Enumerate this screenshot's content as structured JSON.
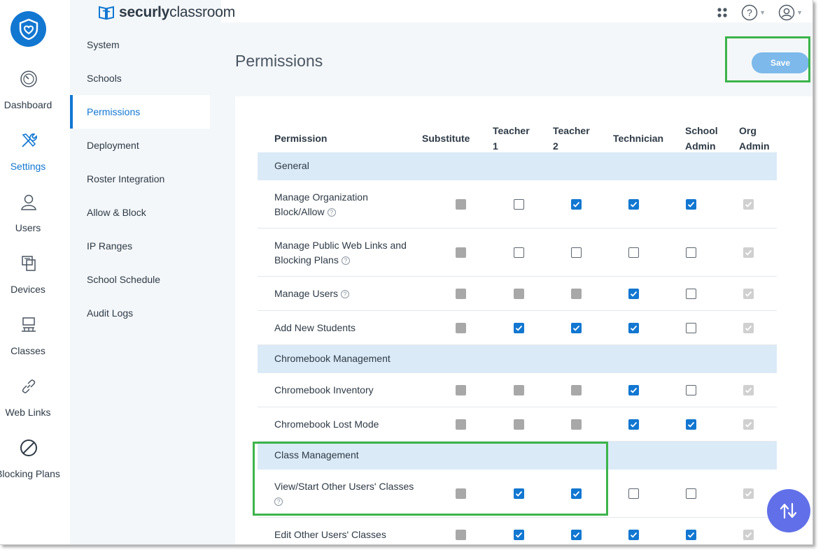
{
  "app": {
    "brand_bold": "securly",
    "brand_light": "classroom"
  },
  "rail": [
    {
      "label": "Dashboard",
      "icon": "speedometer-icon"
    },
    {
      "label": "Settings",
      "icon": "tools-icon",
      "active": true
    },
    {
      "label": "Users",
      "icon": "user-icon"
    },
    {
      "label": "Devices",
      "icon": "devices-icon"
    },
    {
      "label": "Classes",
      "icon": "classes-icon"
    },
    {
      "label": "Web Links",
      "icon": "link-icon"
    },
    {
      "label": "Blocking Plans",
      "icon": "block-icon"
    }
  ],
  "subnav": [
    {
      "label": "System"
    },
    {
      "label": "Schools"
    },
    {
      "label": "Permissions",
      "active": true
    },
    {
      "label": "Deployment"
    },
    {
      "label": "Roster Integration"
    },
    {
      "label": "Allow & Block"
    },
    {
      "label": "IP Ranges"
    },
    {
      "label": "School Schedule"
    },
    {
      "label": "Audit Logs"
    }
  ],
  "topbar": {
    "apps_icon": "apps-grid-icon",
    "help_icon": "help-icon",
    "account_icon": "account-icon"
  },
  "page": {
    "title": "Permissions",
    "save_label": "Save"
  },
  "table": {
    "headers": {
      "permission": "Permission",
      "substitute": "Substitute",
      "teacher1_a": "Teacher",
      "teacher1_b": "1",
      "teacher2_a": "Teacher",
      "teacher2_b": "2",
      "technician": "Technician",
      "school_admin_a": "School",
      "school_admin_b": "Admin",
      "org_admin_a": "Org",
      "org_admin_b": "Admin"
    },
    "rows": [
      {
        "type": "group",
        "label": "General"
      },
      {
        "type": "perm",
        "line1": "Manage Organization",
        "line2": "Block/Allow",
        "help": true,
        "states": [
          "disabled",
          "unchecked",
          "checked",
          "checked",
          "checked",
          "locked"
        ]
      },
      {
        "type": "perm",
        "line1": "Manage Public Web Links and",
        "line2": "Blocking Plans",
        "help": true,
        "states": [
          "disabled",
          "unchecked",
          "unchecked",
          "unchecked",
          "unchecked",
          "locked"
        ]
      },
      {
        "type": "perm",
        "line1": "Manage Users",
        "line2": "",
        "help": true,
        "states": [
          "disabled",
          "disabled",
          "disabled",
          "checked",
          "unchecked",
          "locked"
        ]
      },
      {
        "type": "perm",
        "line1": "Add New Students",
        "line2": "",
        "help": false,
        "states": [
          "disabled",
          "checked",
          "checked",
          "checked",
          "unchecked",
          "locked"
        ]
      },
      {
        "type": "group",
        "label": "Chromebook Management"
      },
      {
        "type": "perm",
        "line1": "Chromebook Inventory",
        "line2": "",
        "help": false,
        "states": [
          "disabled",
          "disabled",
          "disabled",
          "checked",
          "unchecked",
          "locked"
        ]
      },
      {
        "type": "perm",
        "line1": "Chromebook Lost Mode",
        "line2": "",
        "help": false,
        "states": [
          "disabled",
          "disabled",
          "disabled",
          "checked",
          "checked",
          "locked"
        ]
      },
      {
        "type": "group",
        "label": "Class Management"
      },
      {
        "type": "perm",
        "line1": "View/Start Other Users' Classes",
        "line2": "",
        "help": true,
        "help_below": true,
        "states": [
          "disabled",
          "checked",
          "checked",
          "unchecked",
          "unchecked",
          "locked"
        ]
      },
      {
        "type": "perm",
        "line1": "Edit Other Users' Classes",
        "line2": "",
        "help": false,
        "states": [
          "disabled",
          "checked",
          "checked",
          "checked",
          "checked",
          "locked"
        ]
      }
    ]
  },
  "fab": {
    "icon": "sync-arrows-icon"
  },
  "colors": {
    "accent": "#1277d1",
    "highlight": "#3cb44b",
    "fab": "#6170e8"
  }
}
